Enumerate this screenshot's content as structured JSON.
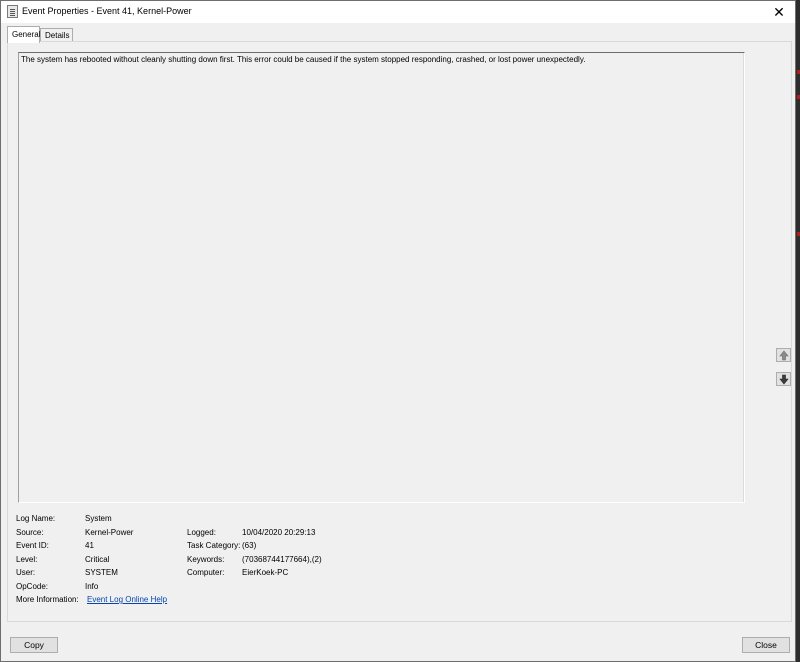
{
  "window": {
    "title": "Event Properties - Event 41, Kernel-Power",
    "close_symbol": "✕"
  },
  "tabs": [
    {
      "label": "General",
      "active": true
    },
    {
      "label": "Details",
      "active": false
    }
  ],
  "description": "The system has rebooted without cleanly shutting down first. This error could be caused if the system stopped responding, crashed, or lost power unexpectedly.",
  "fields": {
    "log_name_label": "Log Name:",
    "log_name_value": "System",
    "source_label": "Source:",
    "source_value": "Kernel-Power",
    "logged_label": "Logged:",
    "logged_value": "10/04/2020 20:29:13",
    "event_id_label": "Event ID:",
    "event_id_value": "41",
    "task_category_label": "Task Category:",
    "task_category_value": "(63)",
    "level_label": "Level:",
    "level_value": "Critical",
    "keywords_label": "Keywords:",
    "keywords_value": "(70368744177664),(2)",
    "user_label": "User:",
    "user_value": "SYSTEM",
    "computer_label": "Computer:",
    "computer_value": "EierKoek-PC",
    "opcode_label": "OpCode:",
    "opcode_value": "Info",
    "more_info_label": "More Information:",
    "more_info_link": "Event Log Online Help"
  },
  "buttons": {
    "copy": "Copy",
    "close": "Close"
  },
  "icons": {
    "title": "event-properties-icon",
    "up": "arrow-up-icon",
    "down": "arrow-down-icon"
  }
}
